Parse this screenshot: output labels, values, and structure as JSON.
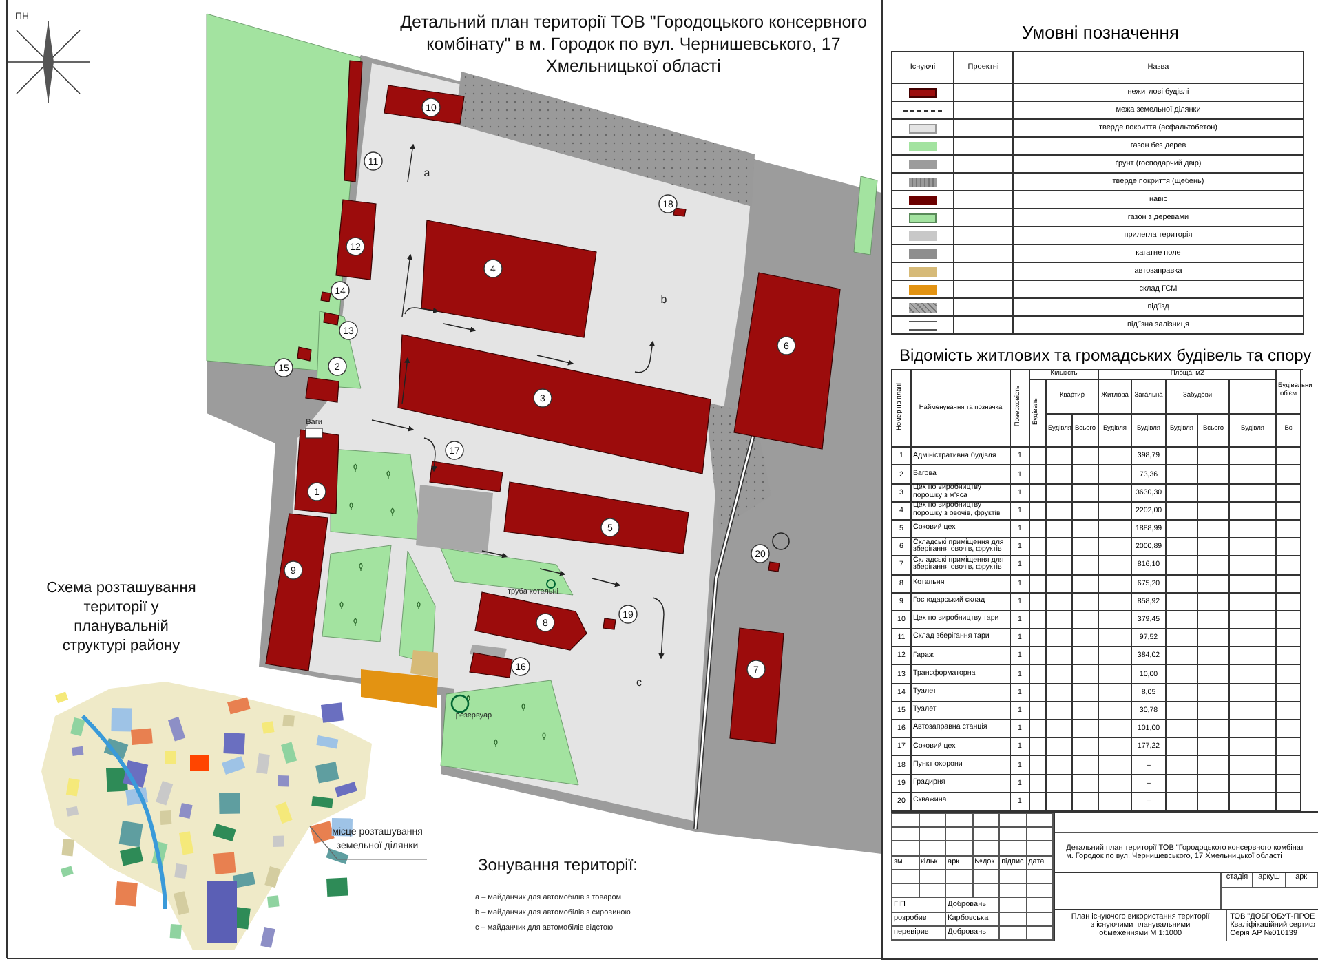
{
  "title_lines": [
    "Детальний план території ТОВ \"Городоцького консервного",
    "комбінату\" в м. Городок по вул. Чернишевського, 17",
    "Хмельницької області"
  ],
  "compass": {
    "label": "ПН"
  },
  "site_plan": {
    "building_labels": [
      "1",
      "2",
      "3",
      "4",
      "5",
      "6",
      "7",
      "8",
      "9",
      "10",
      "11",
      "12",
      "13",
      "14",
      "15",
      "16",
      "17",
      "18",
      "19",
      "20"
    ],
    "zone_labels": [
      "a",
      "b",
      "c"
    ],
    "annotations": [
      {
        "kind": "scale",
        "text": "Ваги"
      },
      {
        "kind": "chimney",
        "text": "труба котельні"
      },
      {
        "kind": "tank",
        "text": "резервуар"
      }
    ]
  },
  "district_scheme": {
    "title_lines": [
      "Схема розташування",
      "території у",
      "планувальній",
      "структурі району"
    ],
    "callout_lines": [
      "місце розташування",
      "земельної ділянки"
    ]
  },
  "zoning": {
    "title": "Зонування території:",
    "items": [
      "a – майданчик для автомобілів з товаром",
      "b – майданчик для автомобілів з сировиною",
      "c – майданчик для автомобілів відстою"
    ]
  },
  "legend": {
    "title": "Умовні позначення",
    "columns": [
      "Існуючі",
      "Проектні",
      "Назва"
    ],
    "items": [
      {
        "kind": "building",
        "name": "нежитлові будівлі"
      },
      {
        "kind": "boundary",
        "name": "межа земельної ділянки"
      },
      {
        "kind": "asphalt",
        "name": "тверде покриття (асфальтобетон)"
      },
      {
        "kind": "lawn",
        "name": "газон без дерев"
      },
      {
        "kind": "soil",
        "name": "ґрунт (господарчий двір)"
      },
      {
        "kind": "gravel",
        "name": "тверде покриття (щебень)"
      },
      {
        "kind": "canopy",
        "name": "навіс"
      },
      {
        "kind": "lawn_trees",
        "name": "газон з деревами"
      },
      {
        "kind": "adjacent",
        "name": "прилегла територія"
      },
      {
        "kind": "field",
        "name": "кагатне поле"
      },
      {
        "kind": "fuel",
        "name": "автозаправка"
      },
      {
        "kind": "storage",
        "name": "склад ГСМ"
      },
      {
        "kind": "driveway",
        "name": "під'їзд"
      },
      {
        "kind": "railway",
        "name": "під'їзна залізниця"
      }
    ]
  },
  "buildings_table": {
    "title": "Відомість житлових та громадських будівель та спору",
    "header": {
      "number": "Номер на плані",
      "name": "Найменування та позначка",
      "floors": "Поверховість",
      "count": "Кількість",
      "count_buildings": "Будівель",
      "apartments": "Квартир",
      "apt_building": "Будівля",
      "apt_total": "Всього",
      "area": "Площа, м2",
      "living": "Житлова",
      "living_building": "Будівля",
      "total": "Загальна",
      "total_building": "Будівля",
      "footprint": "Забудови",
      "footprint_building": "Будівля",
      "footprint_total": "Всього",
      "volume": "Будівельни об'єм",
      "volume_building": "Будівля",
      "volume_total": "Вс"
    },
    "rows": [
      {
        "number": "1",
        "name": "Адміністративна будівля",
        "floors": "1",
        "total_area": "398,79"
      },
      {
        "number": "2",
        "name": "Вагова",
        "floors": "1",
        "total_area": "73,36"
      },
      {
        "number": "3",
        "name": "Цех по виробництву порошку з м'яса",
        "floors": "1",
        "total_area": "3630,30"
      },
      {
        "number": "4",
        "name": "Цех по виробництву порошку з овочів, фруктів",
        "floors": "1",
        "total_area": "2202,00"
      },
      {
        "number": "5",
        "name": "Соковий цех",
        "floors": "1",
        "total_area": "1888,99"
      },
      {
        "number": "6",
        "name": "Складські приміщення для зберігання овочів, фруктів",
        "floors": "1",
        "total_area": "2000,89"
      },
      {
        "number": "7",
        "name": "Складські приміщення для зберігання овочів, фруктів",
        "floors": "1",
        "total_area": "816,10"
      },
      {
        "number": "8",
        "name": "Котельня",
        "floors": "1",
        "total_area": "675,20"
      },
      {
        "number": "9",
        "name": "Господарський склад",
        "floors": "1",
        "total_area": "858,92"
      },
      {
        "number": "10",
        "name": "Цех по виробництву тари",
        "floors": "1",
        "total_area": "379,45"
      },
      {
        "number": "11",
        "name": "Склад зберігання тари",
        "floors": "1",
        "total_area": "97,52"
      },
      {
        "number": "12",
        "name": "Гараж",
        "floors": "1",
        "total_area": "384,02"
      },
      {
        "number": "13",
        "name": "Трансформаторна",
        "floors": "1",
        "total_area": "10,00"
      },
      {
        "number": "14",
        "name": "Туалет",
        "floors": "1",
        "total_area": "8,05"
      },
      {
        "number": "15",
        "name": "Туалет",
        "floors": "1",
        "total_area": "30,78"
      },
      {
        "number": "16",
        "name": "Автозаправна станція",
        "floors": "1",
        "total_area": "101,00"
      },
      {
        "number": "17",
        "name": "Соковий цех",
        "floors": "1",
        "total_area": "177,22"
      },
      {
        "number": "18",
        "name": "Пункт охорони",
        "floors": "1",
        "total_area": "–"
      },
      {
        "number": "19",
        "name": "Градирня",
        "floors": "1",
        "total_area": "–"
      },
      {
        "number": "20",
        "name": "Скважина",
        "floors": "1",
        "total_area": "–"
      }
    ]
  },
  "title_block": {
    "change_columns": [
      "зм",
      "кільк",
      "арк",
      "№док",
      "підпис",
      "дата"
    ],
    "signatures": [
      {
        "role": "ГІП",
        "name": "Добровань"
      },
      {
        "role": "розробив",
        "name": "Карбовська"
      },
      {
        "role": "перевірив",
        "name": "Добровань"
      }
    ],
    "project_lines": [
      "Детальний план території ТОВ \"Городоцького консервного комбінат",
      "м. Городок по вул. Чернишевського, 17 Хмельницької області"
    ],
    "stage_columns": [
      "стадія",
      "аркуш",
      "арк"
    ],
    "sheet_lines": [
      "План існуючого використання території",
      "з існуючими планувальними",
      "обмеженнями М 1:1000"
    ],
    "company_lines": [
      "ТОВ \"ДОБРОБУТ-ПРОЕ",
      "Кваліфікаційний сертиф",
      "Серія АР №010139"
    ]
  }
}
